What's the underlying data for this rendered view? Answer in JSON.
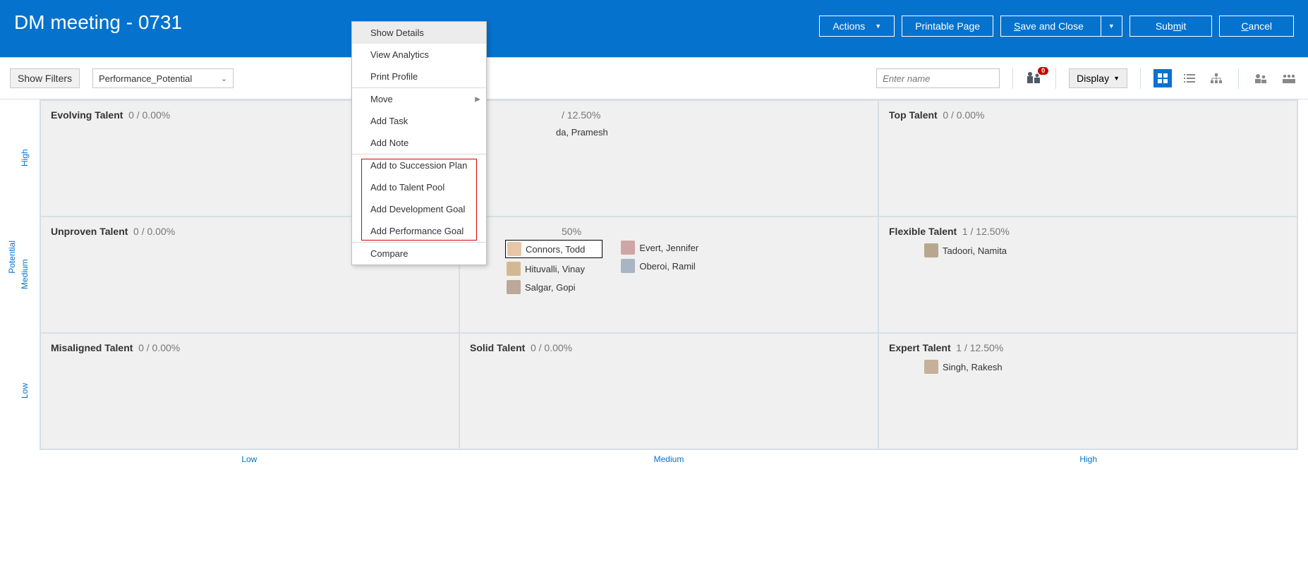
{
  "header": {
    "title": "DM meeting - 0731",
    "actions": "Actions",
    "printable": "Printable Page",
    "save": "Save and Close",
    "save_u": "S",
    "submit": "Submit",
    "submit_u": "m",
    "cancel": "Cancel",
    "cancel_u": "C"
  },
  "toolbar": {
    "show_filters": "Show Filters",
    "select_value": "Performance_Potential",
    "search_placeholder": "Enter name",
    "badge_count": "0",
    "display": "Display"
  },
  "axes": {
    "y_title": "Potential",
    "y": [
      "High",
      "Medium",
      "Low"
    ],
    "x": [
      "Low",
      "Medium",
      "High"
    ]
  },
  "cells": {
    "r0c0": {
      "title": "Evolving Talent",
      "stats": "0 / 0.00%"
    },
    "r0c1": {
      "title_suffix": "/ 12.50%",
      "p1": "da, Pramesh"
    },
    "r0c2": {
      "title": "Top Talent",
      "stats": "0 / 0.00%"
    },
    "r1c0": {
      "title": "Unproven Talent",
      "stats": "0 / 0.00%"
    },
    "r1c1": {
      "title_suffix": "50%",
      "p1": "Connors, Todd",
      "p2": "Hituvalli, Vinay",
      "p3": "Salgar, Gopi",
      "p4": "Evert, Jennifer",
      "p5": "Oberoi, Ramil"
    },
    "r1c2": {
      "title": "Flexible Talent",
      "stats": "1 / 12.50%",
      "p1": "Tadoori, Namita"
    },
    "r2c0": {
      "title": "Misaligned Talent",
      "stats": "0 / 0.00%"
    },
    "r2c1": {
      "title": "Solid Talent",
      "stats": "0 / 0.00%"
    },
    "r2c2": {
      "title": "Expert Talent",
      "stats": "1 / 12.50%",
      "p1": "Singh, Rakesh"
    }
  },
  "menu": {
    "show_details": "Show Details",
    "view_analytics": "View Analytics",
    "print_profile": "Print Profile",
    "move": "Move",
    "add_task": "Add Task",
    "add_note": "Add Note",
    "add_succession": "Add to Succession Plan",
    "add_pool": "Add to Talent Pool",
    "add_dev_goal": "Add Development Goal",
    "add_perf_goal": "Add Performance Goal",
    "compare": "Compare"
  }
}
